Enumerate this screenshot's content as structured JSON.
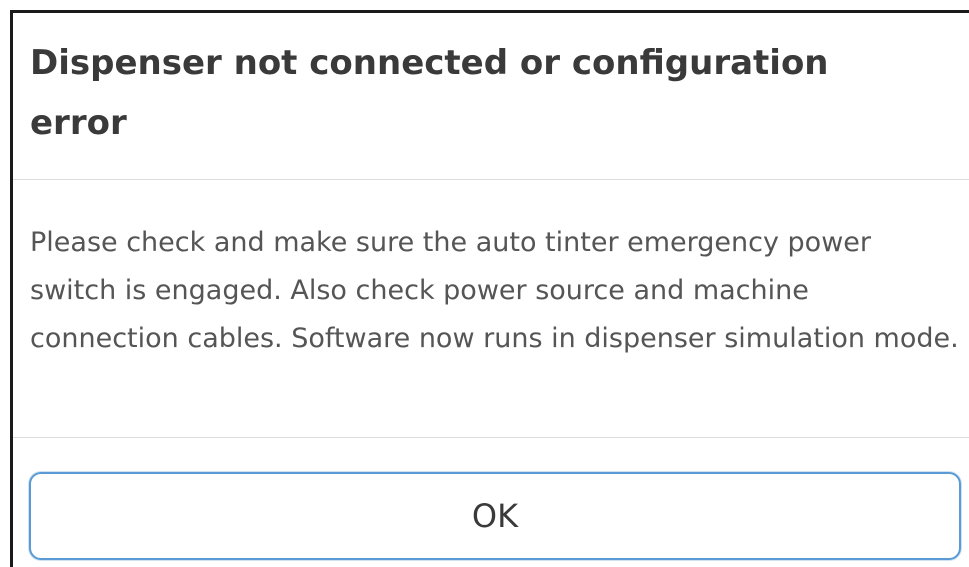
{
  "dialog": {
    "title": "Dispenser not connected or configuration error",
    "message": "Please check and make sure the auto tinter emergency power switch is engaged. Also check power source and machine connection cables. Software now runs in dispenser simulation mode.",
    "ok_label": "OK"
  },
  "colors": {
    "button_border": "#5b9bd5",
    "title_text": "#3a3a3a",
    "body_text": "#555555",
    "divider": "#dcdcdc"
  }
}
